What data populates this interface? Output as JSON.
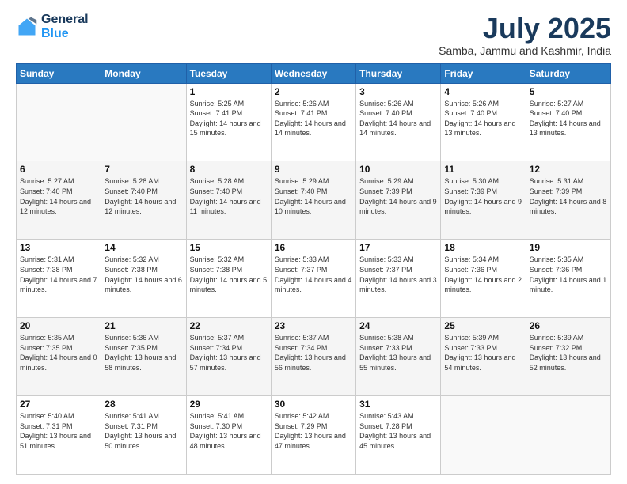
{
  "logo": {
    "line1": "General",
    "line2": "Blue"
  },
  "title": "July 2025",
  "subtitle": "Samba, Jammu and Kashmir, India",
  "days_header": [
    "Sunday",
    "Monday",
    "Tuesday",
    "Wednesday",
    "Thursday",
    "Friday",
    "Saturday"
  ],
  "weeks": [
    [
      {
        "day": "",
        "info": ""
      },
      {
        "day": "",
        "info": ""
      },
      {
        "day": "1",
        "info": "Sunrise: 5:25 AM\nSunset: 7:41 PM\nDaylight: 14 hours and 15 minutes."
      },
      {
        "day": "2",
        "info": "Sunrise: 5:26 AM\nSunset: 7:41 PM\nDaylight: 14 hours and 14 minutes."
      },
      {
        "day": "3",
        "info": "Sunrise: 5:26 AM\nSunset: 7:40 PM\nDaylight: 14 hours and 14 minutes."
      },
      {
        "day": "4",
        "info": "Sunrise: 5:26 AM\nSunset: 7:40 PM\nDaylight: 14 hours and 13 minutes."
      },
      {
        "day": "5",
        "info": "Sunrise: 5:27 AM\nSunset: 7:40 PM\nDaylight: 14 hours and 13 minutes."
      }
    ],
    [
      {
        "day": "6",
        "info": "Sunrise: 5:27 AM\nSunset: 7:40 PM\nDaylight: 14 hours and 12 minutes."
      },
      {
        "day": "7",
        "info": "Sunrise: 5:28 AM\nSunset: 7:40 PM\nDaylight: 14 hours and 12 minutes."
      },
      {
        "day": "8",
        "info": "Sunrise: 5:28 AM\nSunset: 7:40 PM\nDaylight: 14 hours and 11 minutes."
      },
      {
        "day": "9",
        "info": "Sunrise: 5:29 AM\nSunset: 7:40 PM\nDaylight: 14 hours and 10 minutes."
      },
      {
        "day": "10",
        "info": "Sunrise: 5:29 AM\nSunset: 7:39 PM\nDaylight: 14 hours and 9 minutes."
      },
      {
        "day": "11",
        "info": "Sunrise: 5:30 AM\nSunset: 7:39 PM\nDaylight: 14 hours and 9 minutes."
      },
      {
        "day": "12",
        "info": "Sunrise: 5:31 AM\nSunset: 7:39 PM\nDaylight: 14 hours and 8 minutes."
      }
    ],
    [
      {
        "day": "13",
        "info": "Sunrise: 5:31 AM\nSunset: 7:38 PM\nDaylight: 14 hours and 7 minutes."
      },
      {
        "day": "14",
        "info": "Sunrise: 5:32 AM\nSunset: 7:38 PM\nDaylight: 14 hours and 6 minutes."
      },
      {
        "day": "15",
        "info": "Sunrise: 5:32 AM\nSunset: 7:38 PM\nDaylight: 14 hours and 5 minutes."
      },
      {
        "day": "16",
        "info": "Sunrise: 5:33 AM\nSunset: 7:37 PM\nDaylight: 14 hours and 4 minutes."
      },
      {
        "day": "17",
        "info": "Sunrise: 5:33 AM\nSunset: 7:37 PM\nDaylight: 14 hours and 3 minutes."
      },
      {
        "day": "18",
        "info": "Sunrise: 5:34 AM\nSunset: 7:36 PM\nDaylight: 14 hours and 2 minutes."
      },
      {
        "day": "19",
        "info": "Sunrise: 5:35 AM\nSunset: 7:36 PM\nDaylight: 14 hours and 1 minute."
      }
    ],
    [
      {
        "day": "20",
        "info": "Sunrise: 5:35 AM\nSunset: 7:35 PM\nDaylight: 14 hours and 0 minutes."
      },
      {
        "day": "21",
        "info": "Sunrise: 5:36 AM\nSunset: 7:35 PM\nDaylight: 13 hours and 58 minutes."
      },
      {
        "day": "22",
        "info": "Sunrise: 5:37 AM\nSunset: 7:34 PM\nDaylight: 13 hours and 57 minutes."
      },
      {
        "day": "23",
        "info": "Sunrise: 5:37 AM\nSunset: 7:34 PM\nDaylight: 13 hours and 56 minutes."
      },
      {
        "day": "24",
        "info": "Sunrise: 5:38 AM\nSunset: 7:33 PM\nDaylight: 13 hours and 55 minutes."
      },
      {
        "day": "25",
        "info": "Sunrise: 5:39 AM\nSunset: 7:33 PM\nDaylight: 13 hours and 54 minutes."
      },
      {
        "day": "26",
        "info": "Sunrise: 5:39 AM\nSunset: 7:32 PM\nDaylight: 13 hours and 52 minutes."
      }
    ],
    [
      {
        "day": "27",
        "info": "Sunrise: 5:40 AM\nSunset: 7:31 PM\nDaylight: 13 hours and 51 minutes."
      },
      {
        "day": "28",
        "info": "Sunrise: 5:41 AM\nSunset: 7:31 PM\nDaylight: 13 hours and 50 minutes."
      },
      {
        "day": "29",
        "info": "Sunrise: 5:41 AM\nSunset: 7:30 PM\nDaylight: 13 hours and 48 minutes."
      },
      {
        "day": "30",
        "info": "Sunrise: 5:42 AM\nSunset: 7:29 PM\nDaylight: 13 hours and 47 minutes."
      },
      {
        "day": "31",
        "info": "Sunrise: 5:43 AM\nSunset: 7:28 PM\nDaylight: 13 hours and 45 minutes."
      },
      {
        "day": "",
        "info": ""
      },
      {
        "day": "",
        "info": ""
      }
    ]
  ]
}
